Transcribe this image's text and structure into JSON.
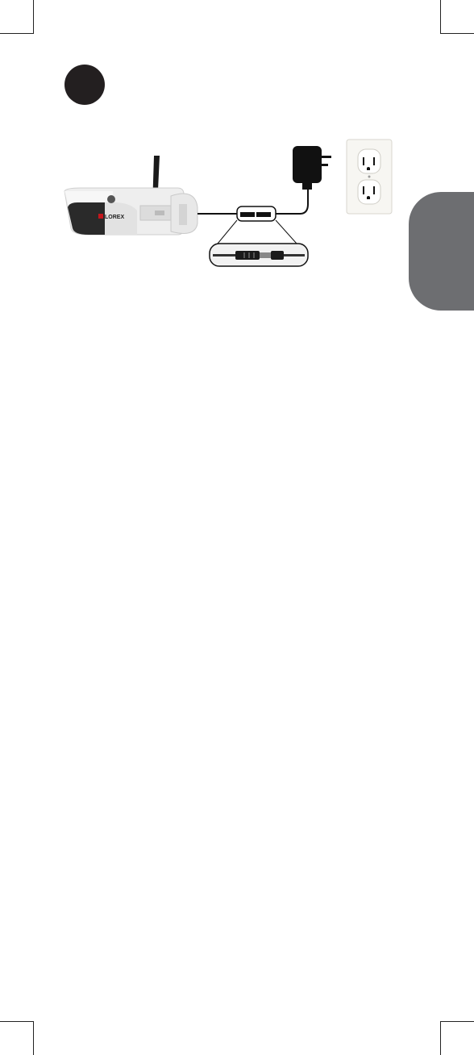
{
  "camera": {
    "brand_logo": "LOREX",
    "brand_color": "#c4161c"
  },
  "colors": {
    "badge": "#231f20",
    "side_tab": "#6d6e71",
    "cable": "#111111"
  }
}
